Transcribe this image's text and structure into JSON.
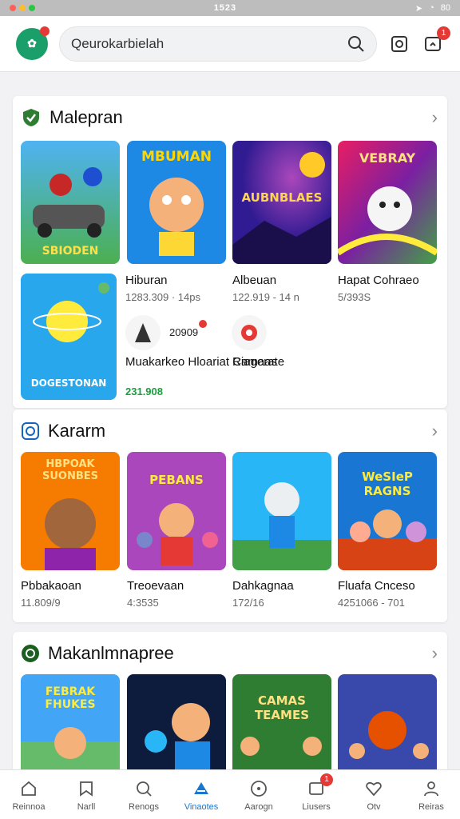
{
  "status": {
    "time": "1523",
    "battery": "80"
  },
  "search": {
    "value": "Qeurokarbielah"
  },
  "header": {
    "notif_count": "1"
  },
  "section1": {
    "title": "Malepran",
    "row1": [
      {
        "art": "SBIODEN",
        "name": "",
        "meta": ""
      },
      {
        "art": "MBUMAN",
        "name": "Hiburan",
        "meta": "1283.309 · 14ps"
      },
      {
        "art": "AUBNBLAES",
        "name": "Albeuan",
        "meta": "122.919 - 14 n"
      },
      {
        "art": "VEBRAY",
        "name": "Hapat Cohraeo",
        "meta": "5/393S"
      }
    ],
    "feature": {
      "art": "DOGESTONAN",
      "name": "Muakarkeo Hloariat Camaas",
      "meta": "231.908"
    },
    "mini_items": [
      {
        "badge_text": "20909",
        "name": ""
      },
      {
        "name": "Riagerate"
      }
    ]
  },
  "section2": {
    "title": "Kararm",
    "items": [
      {
        "art": "HBPOAK SUONBES",
        "name": "Pbbakaoan",
        "meta": "11.809/9"
      },
      {
        "art": "PEBANS",
        "name": "Treoevaan",
        "meta": "4:3535"
      },
      {
        "art": "",
        "name": "Dahkagnaa",
        "meta": "172/16"
      },
      {
        "art": "WeSIeP RAGNS",
        "name": "Fluafa Cnceso",
        "meta": "4251066 - 701"
      }
    ]
  },
  "section3": {
    "title": "Makanlmnapree",
    "items": [
      {
        "art": "FEBRAK FHUKES"
      },
      {
        "art": ""
      },
      {
        "art": "CAMAS TEAMES"
      },
      {
        "art": ""
      }
    ]
  },
  "nav": [
    {
      "label": "Reinnoa",
      "icon": "home-icon"
    },
    {
      "label": "Narll",
      "icon": "bookmark-icon"
    },
    {
      "label": "Renogs",
      "icon": "search-icon"
    },
    {
      "label": "Vinaotes",
      "icon": "game-icon",
      "active": true
    },
    {
      "label": "Aarogn",
      "icon": "compass-icon"
    },
    {
      "label": "Liusers",
      "icon": "inbox-icon",
      "badge": "1"
    },
    {
      "label": "Otv",
      "icon": "heart-icon"
    },
    {
      "label": "Reiras",
      "icon": "profile-icon"
    }
  ],
  "colors": {
    "accent": "#1976d2",
    "brand": "#1a9e6a",
    "badge": "#e53935"
  }
}
